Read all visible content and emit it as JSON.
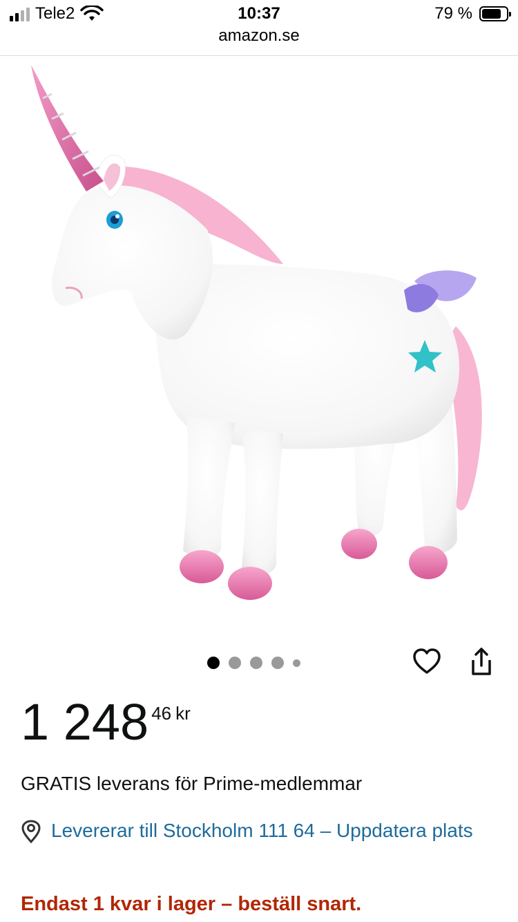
{
  "status_bar": {
    "carrier": "Tele2",
    "time": "10:37",
    "url": "amazon.se",
    "battery": "79 %",
    "battery_level": 0.79
  },
  "product": {
    "image_icon": "unicorn-plush-image",
    "carousel": {
      "total": 5,
      "active_index": 0
    },
    "price": {
      "whole": "1 248",
      "fraction": "46",
      "currency": "kr"
    },
    "delivery_text": "GRATIS leverans för Prime-medlemmar",
    "location_text": "Levererar till Stockholm 111 64 – Uppdatera plats",
    "stock_text": "Endast 1 kvar i lager – beställ snart."
  },
  "colors": {
    "link": "#1d6b9b",
    "stock_warning": "#b12704",
    "dot_active": "#000000",
    "dot_inactive": "#999999"
  }
}
